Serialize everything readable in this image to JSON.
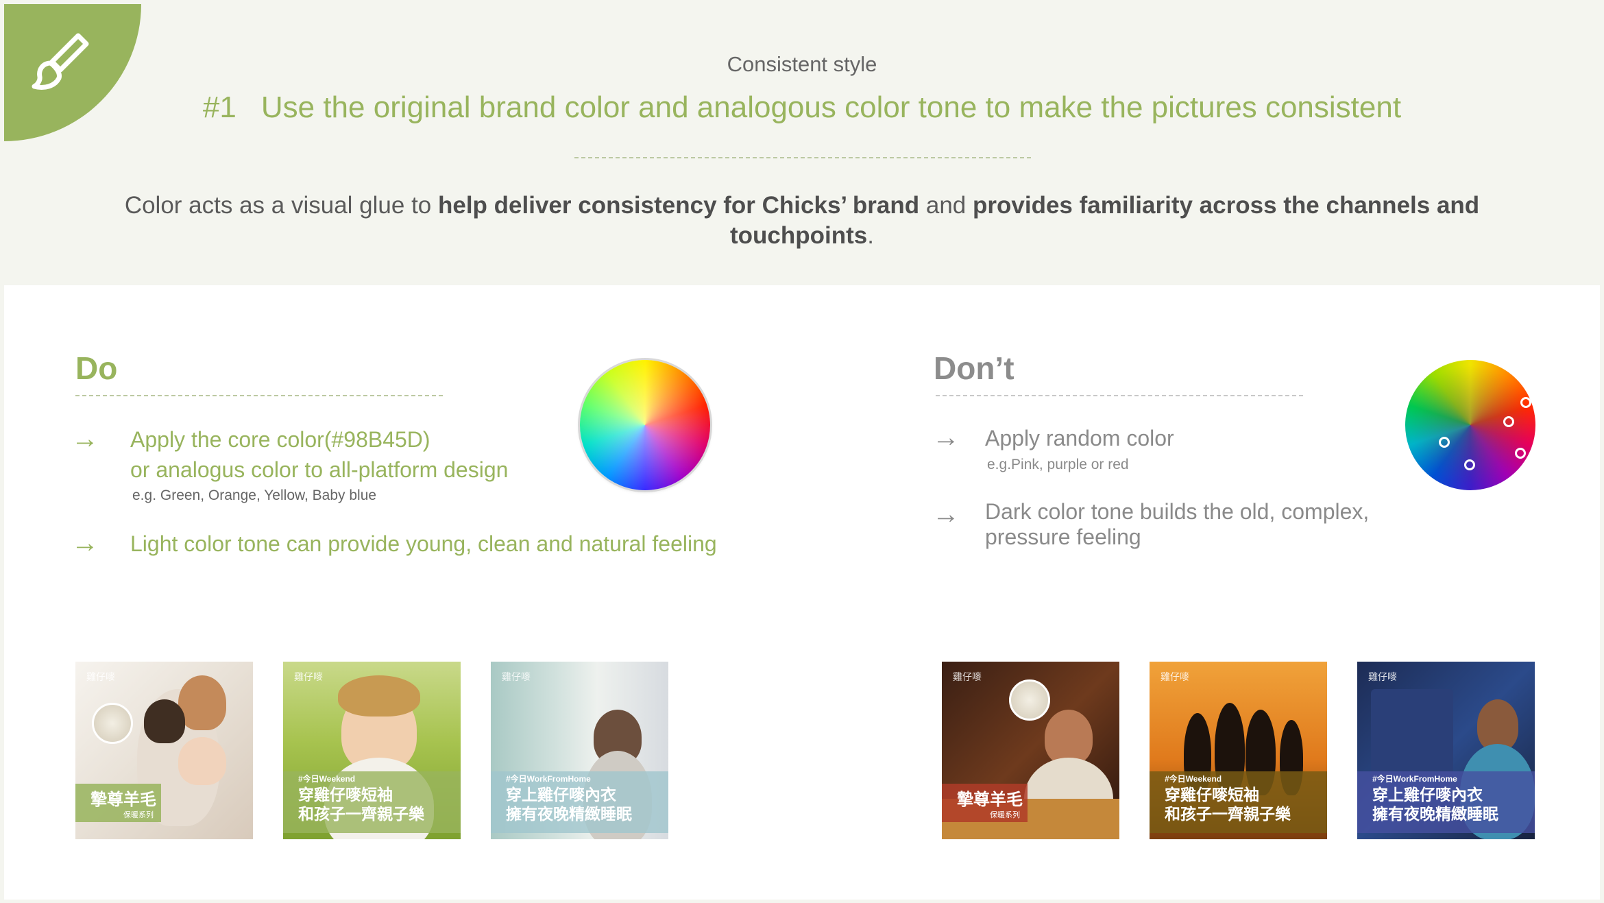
{
  "header": {
    "subtitle": "Consistent style",
    "headline_number": "#1",
    "headline_text": "Use the original brand color and analogous color tone to make the pictures consistent",
    "intro_1": "Color acts as a visual glue to ",
    "intro_2": "help deliver consistency for Chicks’ brand",
    "intro_3": " and ",
    "intro_4": "provides familiarity across the channels and touchpoints",
    "intro_5": "."
  },
  "do": {
    "title": "Do",
    "arrow": "→",
    "item1_line1": "Apply the core color(#98B45D)",
    "item1_line2": "or analogus color to all-platform design",
    "item1_note": "e.g. Green, Orange, Yellow, Baby blue",
    "item2": "Light color tone can provide young, clean and natural feeling"
  },
  "dont": {
    "title": "Don’t",
    "arrow": "→",
    "item1": "Apply random color",
    "item1_note": "e.g.Pink, purple or red",
    "item2_line1": "Dark color tone builds the old, complex,",
    "item2_line2": "pressure feeling"
  },
  "thumbnails": {
    "logo": "雞仔嘜",
    "t1_caption": "摯尊羊毛",
    "t1_sub": "保暖系列",
    "t2_tag": "#今日Weekend",
    "t2_line1": "穿雞仔嘜短袖",
    "t2_line2": "和孩子一齊親子樂",
    "t3_tag": "#今日WorkFromHome",
    "t3_line1": "穿上雞仔嘜內衣",
    "t3_line2": "擁有夜晚精緻睡眠"
  },
  "colors": {
    "brand": "#98B45D",
    "background": "#f4f5ef",
    "grey_text": "#8a8a8a"
  },
  "icons": {
    "corner": "paintbrush-icon",
    "arrow": "arrow-right-icon",
    "wheel_do": "color-wheel-analogous-icon",
    "wheel_dont": "color-wheel-random-icon"
  }
}
